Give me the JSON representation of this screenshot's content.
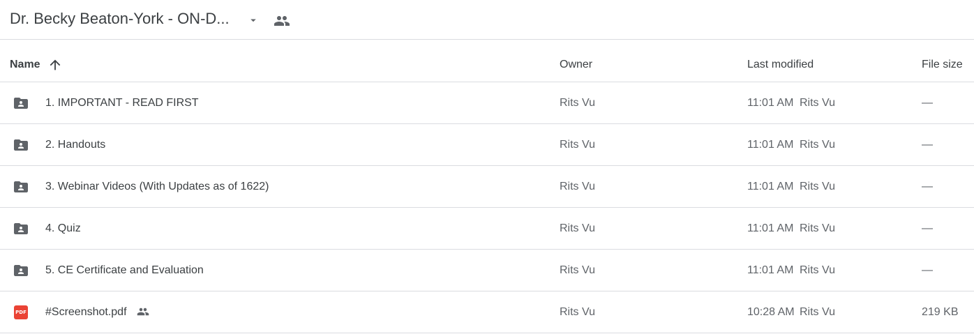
{
  "header": {
    "title": "Dr. Becky Beaton-York - ON-D...",
    "caret_icon": "arrow-drop-down-icon",
    "people_icon": "shared-drive-people-icon"
  },
  "columns": {
    "name": "Name",
    "sort_icon": "arrow-upward-icon",
    "owner": "Owner",
    "last_modified": "Last modified",
    "file_size": "File size"
  },
  "rows": [
    {
      "type": "shared-folder",
      "icon": "shared-folder-icon",
      "name": "1. IMPORTANT - READ FIRST",
      "owner": "Rits Vu",
      "modified_time": "11:01 AM",
      "modified_by": "Rits Vu",
      "size": "—"
    },
    {
      "type": "shared-folder",
      "icon": "shared-folder-icon",
      "name": "2. Handouts",
      "owner": "Rits Vu",
      "modified_time": "11:01 AM",
      "modified_by": "Rits Vu",
      "size": "—"
    },
    {
      "type": "shared-folder",
      "icon": "shared-folder-icon",
      "name": "3. Webinar Videos (With Updates as of 1622)",
      "owner": "Rits Vu",
      "modified_time": "11:01 AM",
      "modified_by": "Rits Vu",
      "size": "—"
    },
    {
      "type": "shared-folder",
      "icon": "shared-folder-icon",
      "name": "4. Quiz",
      "owner": "Rits Vu",
      "modified_time": "11:01 AM",
      "modified_by": "Rits Vu",
      "size": "—"
    },
    {
      "type": "shared-folder",
      "icon": "shared-folder-icon",
      "name": "5. CE Certificate and Evaluation",
      "owner": "Rits Vu",
      "modified_time": "11:01 AM",
      "modified_by": "Rits Vu",
      "size": "—"
    },
    {
      "type": "pdf",
      "icon": "pdf-icon",
      "badge": "PDF",
      "shared": true,
      "name": "#Screenshot.pdf",
      "owner": "Rits Vu",
      "modified_time": "10:28 AM",
      "modified_by": "Rits Vu",
      "size": "219 KB"
    }
  ],
  "colors": {
    "text": "#3c4043",
    "secondary_text": "#5f6368",
    "divider": "#dadce0",
    "folder_icon": "#5f6368",
    "pdf_red": "#ea4335"
  }
}
